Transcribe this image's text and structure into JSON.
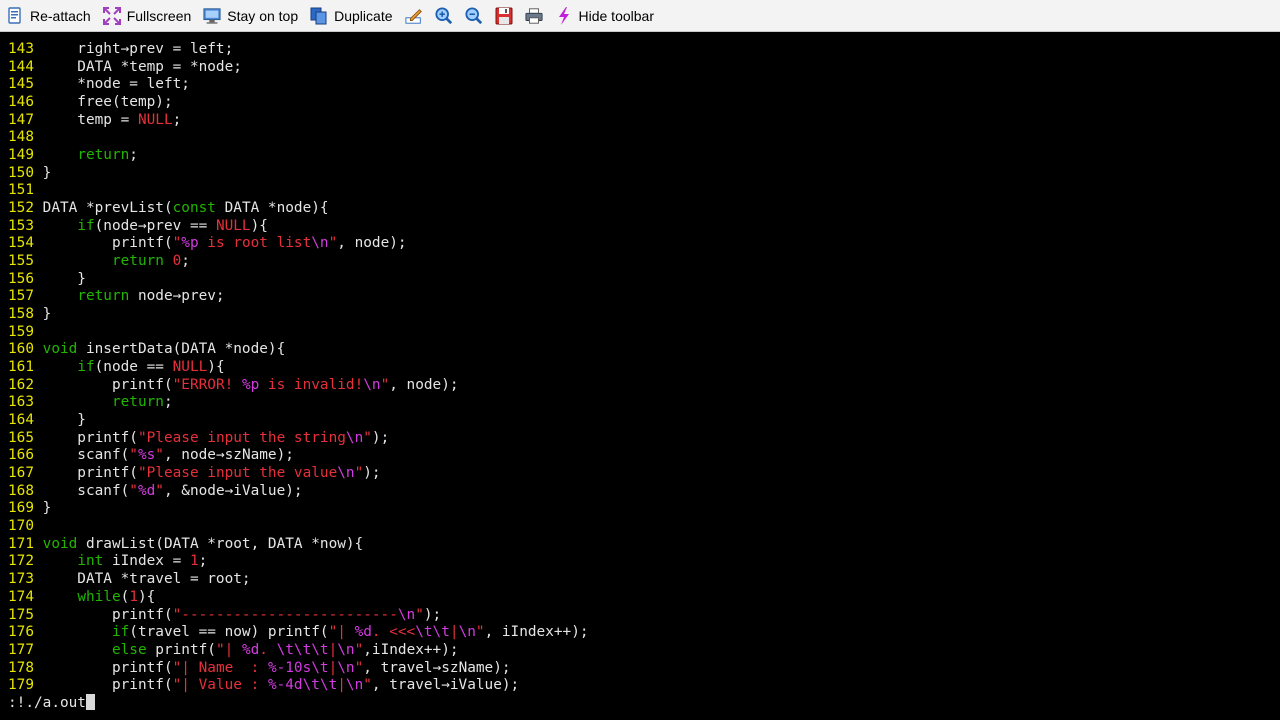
{
  "toolbar": {
    "reattach": "Re-attach",
    "fullscreen": "Fullscreen",
    "stay_on_top": "Stay on top",
    "duplicate": "Duplicate",
    "hide_toolbar": "Hide toolbar"
  },
  "code_lines": [
    {
      "n": "143",
      "t": [
        [
          "    right→prev = left;"
        ]
      ]
    },
    {
      "n": "144",
      "t": [
        [
          "    DATA *temp = *node;"
        ]
      ]
    },
    {
      "n": "145",
      "t": [
        [
          "    *node = left;"
        ]
      ]
    },
    {
      "n": "146",
      "t": [
        [
          "    free(temp);"
        ]
      ]
    },
    {
      "n": "147",
      "t": [
        [
          "    temp = "
        ],
        [
          "NULL",
          "n"
        ],
        [
          ";"
        ]
      ]
    },
    {
      "n": "148",
      "t": [
        [
          ""
        ]
      ]
    },
    {
      "n": "149",
      "t": [
        [
          "    "
        ],
        [
          "return",
          "k"
        ],
        [
          ";"
        ]
      ]
    },
    {
      "n": "150",
      "t": [
        [
          "}"
        ]
      ]
    },
    {
      "n": "151",
      "t": [
        [
          ""
        ]
      ]
    },
    {
      "n": "152",
      "t": [
        [
          "DATA *prevList("
        ],
        [
          "const",
          "k"
        ],
        [
          " DATA *node){"
        ]
      ]
    },
    {
      "n": "153",
      "t": [
        [
          "    "
        ],
        [
          "if",
          "k"
        ],
        [
          "(node→prev == "
        ],
        [
          "NULL",
          "n"
        ],
        [
          "){"
        ]
      ]
    },
    {
      "n": "154",
      "t": [
        [
          "        printf("
        ],
        [
          "\"",
          "s"
        ],
        [
          "%p",
          "f"
        ],
        [
          " is root list",
          "s"
        ],
        [
          "\\n",
          "f"
        ],
        [
          "\"",
          "s"
        ],
        [
          ", node);"
        ]
      ]
    },
    {
      "n": "155",
      "t": [
        [
          "        "
        ],
        [
          "return",
          "k"
        ],
        [
          " "
        ],
        [
          "0",
          "n"
        ],
        [
          ";"
        ]
      ]
    },
    {
      "n": "156",
      "t": [
        [
          "    }"
        ]
      ]
    },
    {
      "n": "157",
      "t": [
        [
          "    "
        ],
        [
          "return",
          "k"
        ],
        [
          " node→prev;"
        ]
      ]
    },
    {
      "n": "158",
      "t": [
        [
          "}"
        ]
      ]
    },
    {
      "n": "159",
      "t": [
        [
          ""
        ]
      ]
    },
    {
      "n": "160",
      "t": [
        [
          "void",
          "k"
        ],
        [
          " insertData(DATA *node){"
        ]
      ]
    },
    {
      "n": "161",
      "t": [
        [
          "    "
        ],
        [
          "if",
          "k"
        ],
        [
          "(node == "
        ],
        [
          "NULL",
          "n"
        ],
        [
          "){"
        ]
      ]
    },
    {
      "n": "162",
      "t": [
        [
          "        printf("
        ],
        [
          "\"ERROR! ",
          "s"
        ],
        [
          "%p",
          "f"
        ],
        [
          " is invalid!",
          "s"
        ],
        [
          "\\n",
          "f"
        ],
        [
          "\"",
          "s"
        ],
        [
          ", node);"
        ]
      ]
    },
    {
      "n": "163",
      "t": [
        [
          "        "
        ],
        [
          "return",
          "k"
        ],
        [
          ";"
        ]
      ]
    },
    {
      "n": "164",
      "t": [
        [
          "    }"
        ]
      ]
    },
    {
      "n": "165",
      "t": [
        [
          "    printf("
        ],
        [
          "\"Please input the string",
          "s"
        ],
        [
          "\\n",
          "f"
        ],
        [
          "\"",
          "s"
        ],
        [
          ");"
        ]
      ]
    },
    {
      "n": "166",
      "t": [
        [
          "    scanf("
        ],
        [
          "\"",
          "s"
        ],
        [
          "%s",
          "f"
        ],
        [
          "\"",
          "s"
        ],
        [
          ", node→szName);"
        ]
      ]
    },
    {
      "n": "167",
      "t": [
        [
          "    printf("
        ],
        [
          "\"Please input the value",
          "s"
        ],
        [
          "\\n",
          "f"
        ],
        [
          "\"",
          "s"
        ],
        [
          ");"
        ]
      ]
    },
    {
      "n": "168",
      "t": [
        [
          "    scanf("
        ],
        [
          "\"",
          "s"
        ],
        [
          "%d",
          "f"
        ],
        [
          "\"",
          "s"
        ],
        [
          ", &node→iValue);"
        ]
      ]
    },
    {
      "n": "169",
      "t": [
        [
          "}"
        ]
      ]
    },
    {
      "n": "170",
      "t": [
        [
          ""
        ]
      ]
    },
    {
      "n": "171",
      "t": [
        [
          "void",
          "k"
        ],
        [
          " drawList(DATA *root, DATA *now){"
        ]
      ]
    },
    {
      "n": "172",
      "t": [
        [
          "    "
        ],
        [
          "int",
          "k"
        ],
        [
          " iIndex = "
        ],
        [
          "1",
          "n"
        ],
        [
          ";"
        ]
      ]
    },
    {
      "n": "173",
      "t": [
        [
          "    DATA *travel = root;"
        ]
      ]
    },
    {
      "n": "174",
      "t": [
        [
          "    "
        ],
        [
          "while",
          "k"
        ],
        [
          "("
        ],
        [
          "1",
          "n"
        ],
        [
          "){"
        ]
      ]
    },
    {
      "n": "175",
      "t": [
        [
          "        printf("
        ],
        [
          "\"-------------------------",
          "s"
        ],
        [
          "\\n",
          "f"
        ],
        [
          "\"",
          "s"
        ],
        [
          ");"
        ]
      ]
    },
    {
      "n": "176",
      "t": [
        [
          "        "
        ],
        [
          "if",
          "k"
        ],
        [
          "(travel == now) printf("
        ],
        [
          "\"| ",
          "s"
        ],
        [
          "%d",
          "f"
        ],
        [
          ". <<<",
          "s"
        ],
        [
          "\\t\\t",
          "f"
        ],
        [
          "|",
          "s"
        ],
        [
          "\\n",
          "f"
        ],
        [
          "\"",
          "s"
        ],
        [
          ", iIndex++);"
        ]
      ]
    },
    {
      "n": "177",
      "t": [
        [
          "        "
        ],
        [
          "else",
          "k"
        ],
        [
          " printf("
        ],
        [
          "\"| ",
          "s"
        ],
        [
          "%d",
          "f"
        ],
        [
          ". ",
          "s"
        ],
        [
          "\\t\\t\\t",
          "f"
        ],
        [
          "|",
          "s"
        ],
        [
          "\\n",
          "f"
        ],
        [
          "\"",
          "s"
        ],
        [
          ",iIndex++);"
        ]
      ]
    },
    {
      "n": "178",
      "t": [
        [
          "        printf("
        ],
        [
          "\"| Name  : ",
          "s"
        ],
        [
          "%-10s\\t",
          "f"
        ],
        [
          "|",
          "s"
        ],
        [
          "\\n",
          "f"
        ],
        [
          "\"",
          "s"
        ],
        [
          ", travel→szName);"
        ]
      ]
    },
    {
      "n": "179",
      "t": [
        [
          "        printf("
        ],
        [
          "\"| Value : ",
          "s"
        ],
        [
          "%-4d\\t\\t",
          "f"
        ],
        [
          "|",
          "s"
        ],
        [
          "\\n",
          "f"
        ],
        [
          "\"",
          "s"
        ],
        [
          ", travel→iValue);"
        ]
      ]
    }
  ],
  "command_line": ":!./a.out",
  "colors": {
    "line_number": "#e5e500",
    "keyword": "#21b500",
    "string": "#e5303a",
    "format": "#d33be0",
    "text": "#e5e5e5",
    "background": "#000000"
  },
  "icons": [
    "reattach-icon",
    "fullscreen-icon",
    "stay-on-top-icon",
    "duplicate-icon",
    "edit-icon",
    "zoom-in-icon",
    "zoom-out-icon",
    "save-icon",
    "print-icon",
    "hide-toolbar-icon"
  ]
}
